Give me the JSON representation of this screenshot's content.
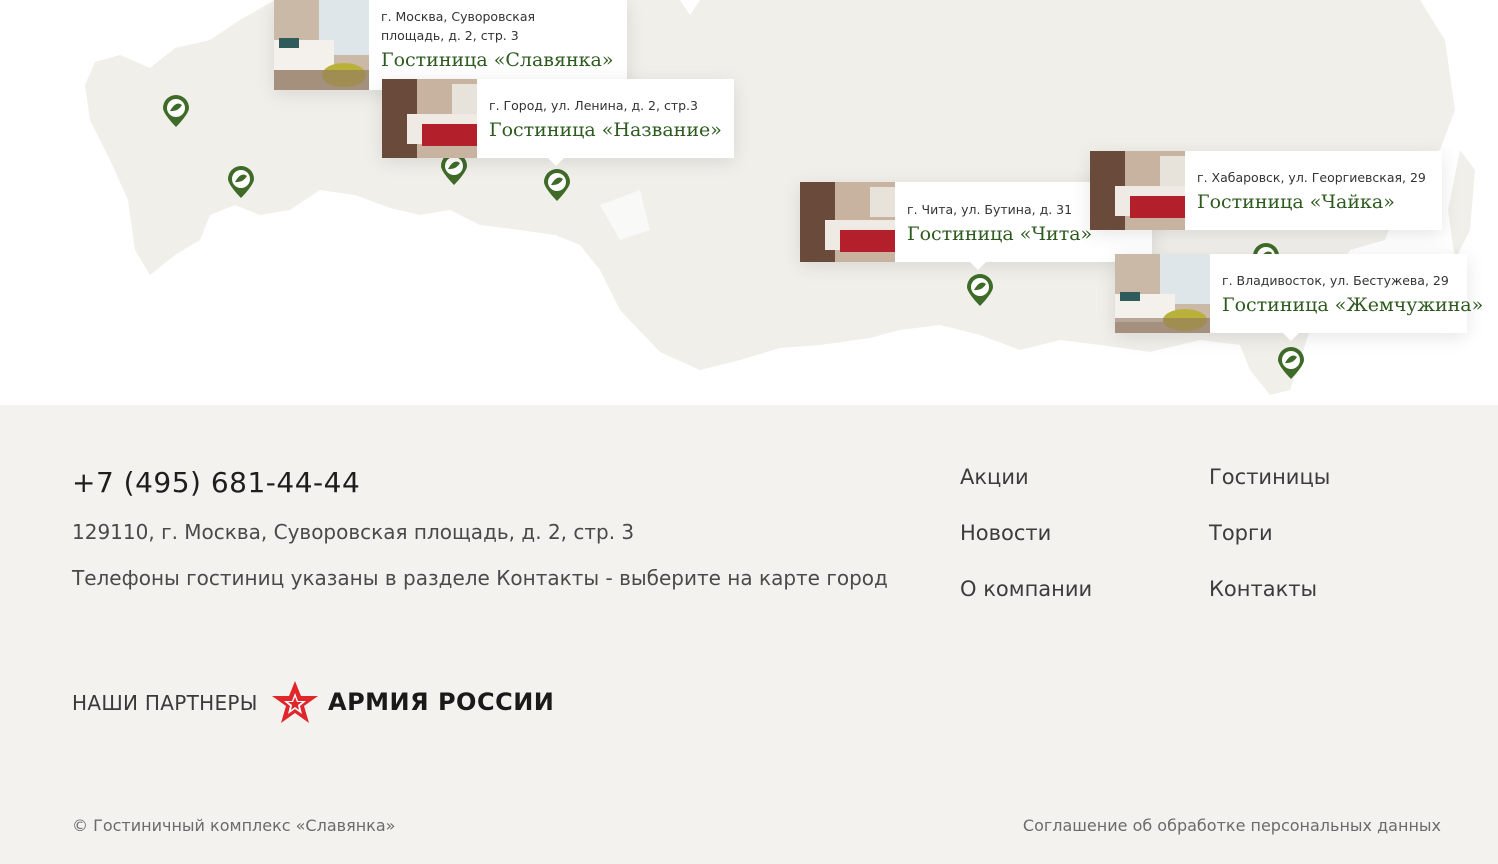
{
  "map": {
    "hotels": [
      {
        "address": "г. Москва, Суворовская площадь, д. 2, стр. 3",
        "name": "Гостиница «Славянка»"
      },
      {
        "address": "г. Город, ул. Ленина, д. 2, стр.3",
        "name": "Гостиница «Название»"
      },
      {
        "address": "г. Чита, ул. Бутина, д. 31",
        "name": "Гостиница «Чита»"
      },
      {
        "address": "г. Хабаровск, ул. Георгиевская, 29",
        "name": "Гостиница «Чайка»"
      },
      {
        "address": "г. Владивосток, ул. Бестужева, 29",
        "name": "Гостиница «Жемчужина»"
      }
    ],
    "colors": {
      "land": "#f1efea",
      "pin": "#3f6b29",
      "hotel_name": "#2d5a1e"
    }
  },
  "footer": {
    "phone": "+7 (495) 681-44-44",
    "address": "129110, г. Москва, Суворовская площадь, д. 2, стр. 3",
    "note": "Телефоны гостиниц указаны в разделе Контакты - выберите на карте город",
    "nav": {
      "promotions": "Акции",
      "hotels": "Гостиницы",
      "news": "Новости",
      "tenders": "Торги",
      "about": "О компании",
      "contacts": "Контакты"
    },
    "partners_label": "НАШИ ПАРТНЕРЫ",
    "partner_logo_text": "АРМИЯ РОССИИ",
    "copyright": "© Гостиничный комплекс «Славянка»",
    "agreement": "Соглашение об обработке персональных данных",
    "background": "#f4f2ee"
  }
}
